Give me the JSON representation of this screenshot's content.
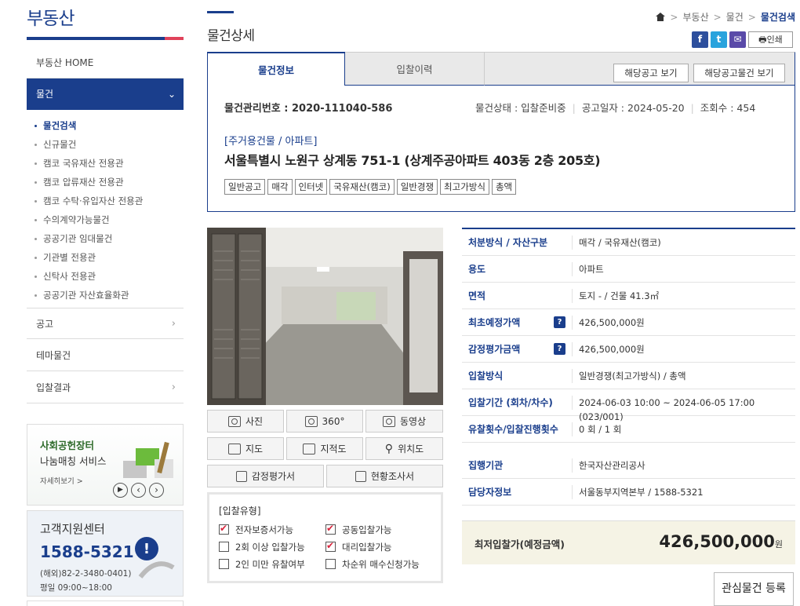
{
  "sidebar": {
    "title": "부동산",
    "home": "부동산 HOME",
    "active": "물건",
    "sub_items": [
      {
        "label": "물건검색",
        "active": true
      },
      {
        "label": "신규물건",
        "active": false
      },
      {
        "label": "캠코 국유재산 전용관",
        "active": false
      },
      {
        "label": "캠코 압류재산 전용관",
        "active": false
      },
      {
        "label": "캠코 수탁·유입자산 전용관",
        "active": false
      },
      {
        "label": "수의계약가능물건",
        "active": false
      },
      {
        "label": "공공기관 임대물건",
        "active": false
      },
      {
        "label": "기관별 전용관",
        "active": false
      },
      {
        "label": "신탁사 전용관",
        "active": false
      },
      {
        "label": "공공기관 자산효율화관",
        "active": false
      }
    ],
    "lower_items": [
      "공고",
      "테마물건",
      "입찰결과"
    ],
    "banner": {
      "line1": "사회공헌장터",
      "line2": "나눔매칭 서비스",
      "more": "자세히보기 >"
    },
    "support": {
      "title": "고객지원센터",
      "phone": "1588-5321",
      "overseas": "(해외)82-2-3480-0401)",
      "hours": "평일 09:00~18:00"
    }
  },
  "header": {
    "page_title": "물건상세",
    "breadcrumb": [
      "부동산",
      "물건",
      "물건검색"
    ],
    "print_label": "인쇄"
  },
  "tabs": [
    "물건정보",
    "입찰이력"
  ],
  "buttons": {
    "notice": "해당공고 보기",
    "notice_items": "해당공고물건 보기",
    "favorite": "관심물건 등록"
  },
  "item": {
    "mgmt_no_label": "물건관리번호 : ",
    "mgmt_no": "2020-111040-586",
    "status": "물건상태 : 입찰준비중",
    "notice_date": "공고일자 : 2024-05-20",
    "views": "조회수 : 454",
    "category": "[주거용건물 / 아파트]",
    "address": "서울특별시 노원구 상계동 751-1 (상계주공아파트 403동 2층 205호)",
    "tags": [
      "일반공고",
      "매각",
      "인터넷",
      "국유재산(캠코)",
      "일반경쟁",
      "최고가방식",
      "총액"
    ]
  },
  "media_buttons": [
    "사진",
    "360°",
    "동영상",
    "지도",
    "지적도",
    "위치도",
    "감정평가서",
    "현황조사서"
  ],
  "bid_type": {
    "title": "[입찰유형]",
    "options": [
      {
        "label": "전자보증서가능",
        "checked": true
      },
      {
        "label": "공동입찰가능",
        "checked": true
      },
      {
        "label": "2회 이상 입찰가능",
        "checked": false
      },
      {
        "label": "대리입찰가능",
        "checked": true
      },
      {
        "label": "2인 미만 유찰여부",
        "checked": false
      },
      {
        "label": "차순위 매수신청가능",
        "checked": false
      }
    ]
  },
  "details": [
    {
      "label": "처분방식 / 자산구분",
      "value": "매각 / 국유재산(캠코)",
      "help": false
    },
    {
      "label": "용도",
      "value": "아파트",
      "help": false
    },
    {
      "label": "면적",
      "value": "토지 - / 건물 41.3㎡",
      "help": false
    },
    {
      "label": "최초예정가액",
      "value": "426,500,000원",
      "help": true
    },
    {
      "label": "감정평가금액",
      "value": "426,500,000원",
      "help": true
    },
    {
      "label": "입찰방식",
      "value": "일반경쟁(최고가방식) / 총액",
      "help": false
    },
    {
      "label": "입찰기간 (회차/차수)",
      "value": "2024-06-03 10:00 ~ 2024-06-05 17:00 (023/001)",
      "help": false
    },
    {
      "label": "유찰횟수/입찰진행횟수",
      "value": "0 회 / 1 회",
      "help": false
    },
    {
      "label": "집행기관",
      "value": "한국자산관리공사",
      "help": false
    },
    {
      "label": "담당자정보",
      "value": "서울동부지역본부 / 1588-5321",
      "help": false
    }
  ],
  "min_price": {
    "label": "최저입찰가(예정금액)",
    "value": "426,500,000",
    "unit": "원"
  }
}
